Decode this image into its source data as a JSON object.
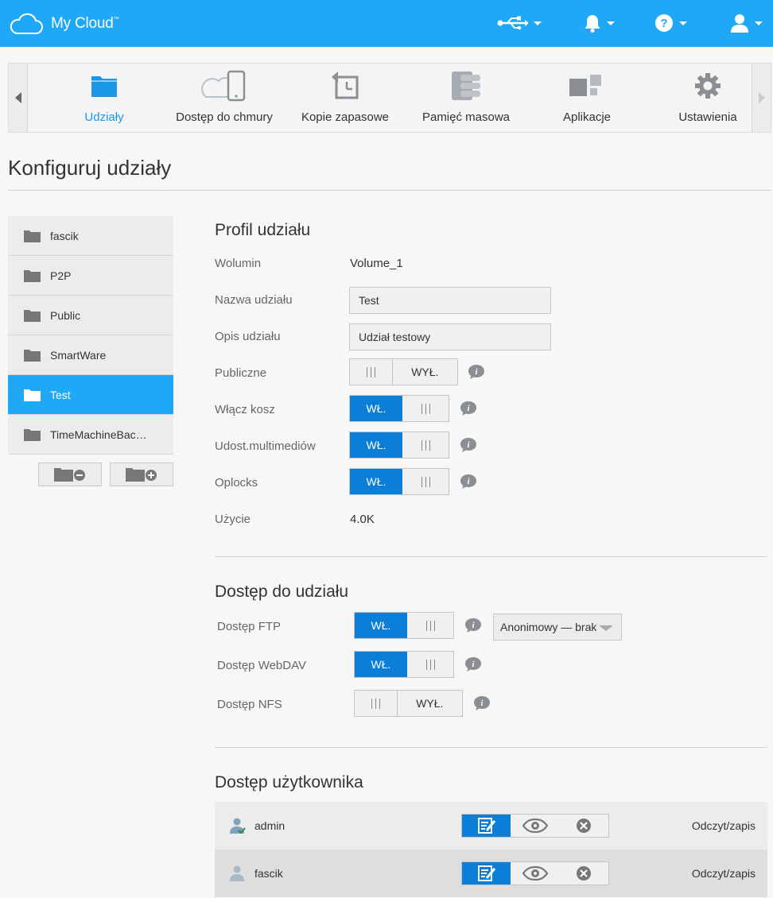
{
  "app": {
    "title": "My Cloud",
    "trademark": "™"
  },
  "header": {
    "icons": [
      "usb-icon",
      "bell-icon",
      "help-icon",
      "user-icon"
    ]
  },
  "nav": {
    "tabs": [
      {
        "label": "Udziały",
        "icon": "folder-icon",
        "active": true
      },
      {
        "label": "Dostęp do chmury",
        "icon": "cloud-device-icon",
        "active": false
      },
      {
        "label": "Kopie zapasowe",
        "icon": "backup-icon",
        "active": false
      },
      {
        "label": "Pamięć masowa",
        "icon": "storage-icon",
        "active": false
      },
      {
        "label": "Aplikacje",
        "icon": "apps-icon",
        "active": false
      },
      {
        "label": "Ustawienia",
        "icon": "gear-icon",
        "active": false
      }
    ]
  },
  "page": {
    "title": "Konfiguruj udziały"
  },
  "shares": {
    "items": [
      {
        "label": "fascik"
      },
      {
        "label": "P2P"
      },
      {
        "label": "Public"
      },
      {
        "label": "SmartWare"
      },
      {
        "label": "Test"
      },
      {
        "label": "TimeMachineBac…"
      }
    ],
    "selected": "Test"
  },
  "profile": {
    "title": "Profil udziału",
    "volume_label": "Wolumin",
    "volume_value": "Volume_1",
    "name_label": "Nazwa udziału",
    "name_value": "Test",
    "desc_label": "Opis udziału",
    "desc_value": "Udział testowy",
    "public_label": "Publiczne",
    "public_state": "WYŁ.",
    "recycle_label": "Włącz kosz",
    "recycle_state": "WŁ.",
    "media_label": "Udost.multimediów",
    "media_state": "WŁ.",
    "oplocks_label": "Oplocks",
    "oplocks_state": "WŁ.",
    "usage_label": "Użycie",
    "usage_value": "4.0K"
  },
  "access": {
    "title": "Dostęp do udziału",
    "ftp_label": "Dostęp FTP",
    "ftp_state": "WŁ.",
    "ftp_anon": "Anonimowy — brak",
    "webdav_label": "Dostęp WebDAV",
    "webdav_state": "WŁ.",
    "nfs_label": "Dostęp NFS",
    "nfs_state": "WYŁ."
  },
  "users": {
    "title": "Dostęp użytkownika",
    "rows": [
      {
        "name": "admin",
        "permission": "Odczyt/zapis"
      },
      {
        "name": "fascik",
        "permission": "Odczyt/zapis"
      }
    ]
  },
  "colors": {
    "brand": "#1fa8f5",
    "toggle_on": "#0b7fd8"
  }
}
